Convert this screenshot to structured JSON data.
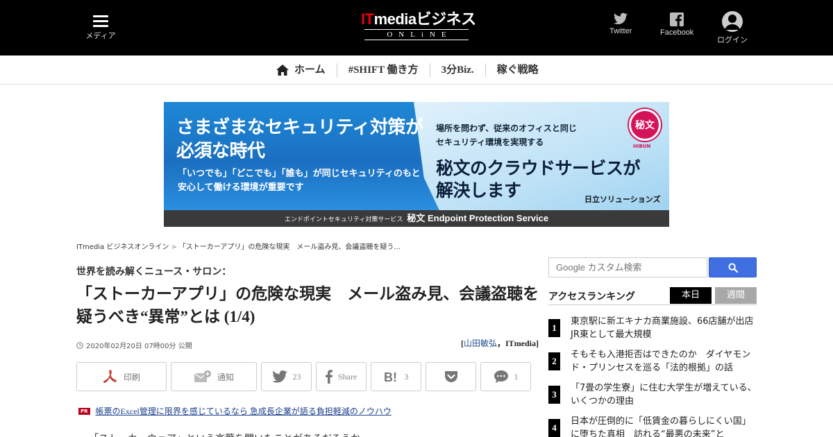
{
  "header": {
    "menu_label": "メディア",
    "logo_main": "ITmediaビジネス",
    "logo_it": "IT",
    "logo_rest": "mediaビジネス",
    "logo_sub": "ONLiNE",
    "twitter_label": "Twitter",
    "facebook_label": "Facebook",
    "login_label": "ログイン"
  },
  "nav": {
    "items": [
      {
        "label": "ホーム",
        "icon": "home-icon"
      },
      {
        "label": "#SHIFT 働き方"
      },
      {
        "label": "3分Biz."
      },
      {
        "label": "稼ぐ戦略"
      }
    ]
  },
  "banner": {
    "headline_1": "さまざまなセキュリティ対策が",
    "headline_2": "必須な時代",
    "sub_1": "「いつでも」「どこでも」「誰も」が同じセキュリティのもと",
    "sub_2": "安心して働ける環境が重要です",
    "right_1": "場所を問わず、従来のオフィスと同じ",
    "right_2": "セキュリティ環境を実現する",
    "right_big_1": "秘文のクラウドサービスが",
    "right_big_2": "解決します",
    "company": "日立ソリューションズ",
    "logo_text": "秘文",
    "logo_caption": "HIBUN",
    "footer_small": "エンドポイントセキュリティ対策サービス",
    "footer_big": "秘文 Endpoint Protection Service"
  },
  "breadcrumb": {
    "home": "ITmedia ビジネスオンライン",
    "separator": ">",
    "current": "「ストーカーアプリ」の危険な現実　メール盗み見、会議盗聴を疑う..."
  },
  "article": {
    "kicker": "世界を読み解くニュース・サロン：",
    "title": "「ストーカーアプリ」の危険な現実　メール盗み見、会議盗聴を疑うべき“異常”とは (1/4)",
    "date": "2020年02月20日 07時00分 公開",
    "byline_open": "[",
    "author": "山田敏弘",
    "byline_rest": "，ITmedia]",
    "share": {
      "print": "印刷",
      "notify": "通知",
      "twitter_count": "23",
      "facebook_label": "Share",
      "hatena_count": "3",
      "comment_count": "1"
    },
    "pr_badge": "PR",
    "pr_link": "帳票のExcel管理に限界を感じているなら 急成長企業が語る負担軽減のノウハウ",
    "body_start": "「ストーカーウェア」という言葉を聞いたことがあるだろうか。"
  },
  "sidebar": {
    "search_placeholder": "Google カスタム検索",
    "ranking_title": "アクセスランキング",
    "tab_today": "本日",
    "tab_week": "週間",
    "ranking": [
      {
        "rank": "1",
        "title": "東京駅に新エキナカ商業施設、66店舗が出店　JR東として最大規模"
      },
      {
        "rank": "2",
        "title": "そもそも入港拒否はできたのか　ダイヤモンド・プリンセスを巡る「法的根拠」の話"
      },
      {
        "rank": "3",
        "title": "「7畳の学生寮」に住む大学生が増えている、いくつかの理由"
      },
      {
        "rank": "4",
        "title": "日本が圧倒的に「低賃金の暮らしにくい国」に堕ちた真相　訪れる“最悪の未来”と"
      }
    ]
  },
  "colors": {
    "header_bg": "#000000",
    "logo_accent": "#e60012",
    "search_button": "#3f6fe0",
    "pr_badge": "#b8001c",
    "link": "#1a3f8a"
  }
}
